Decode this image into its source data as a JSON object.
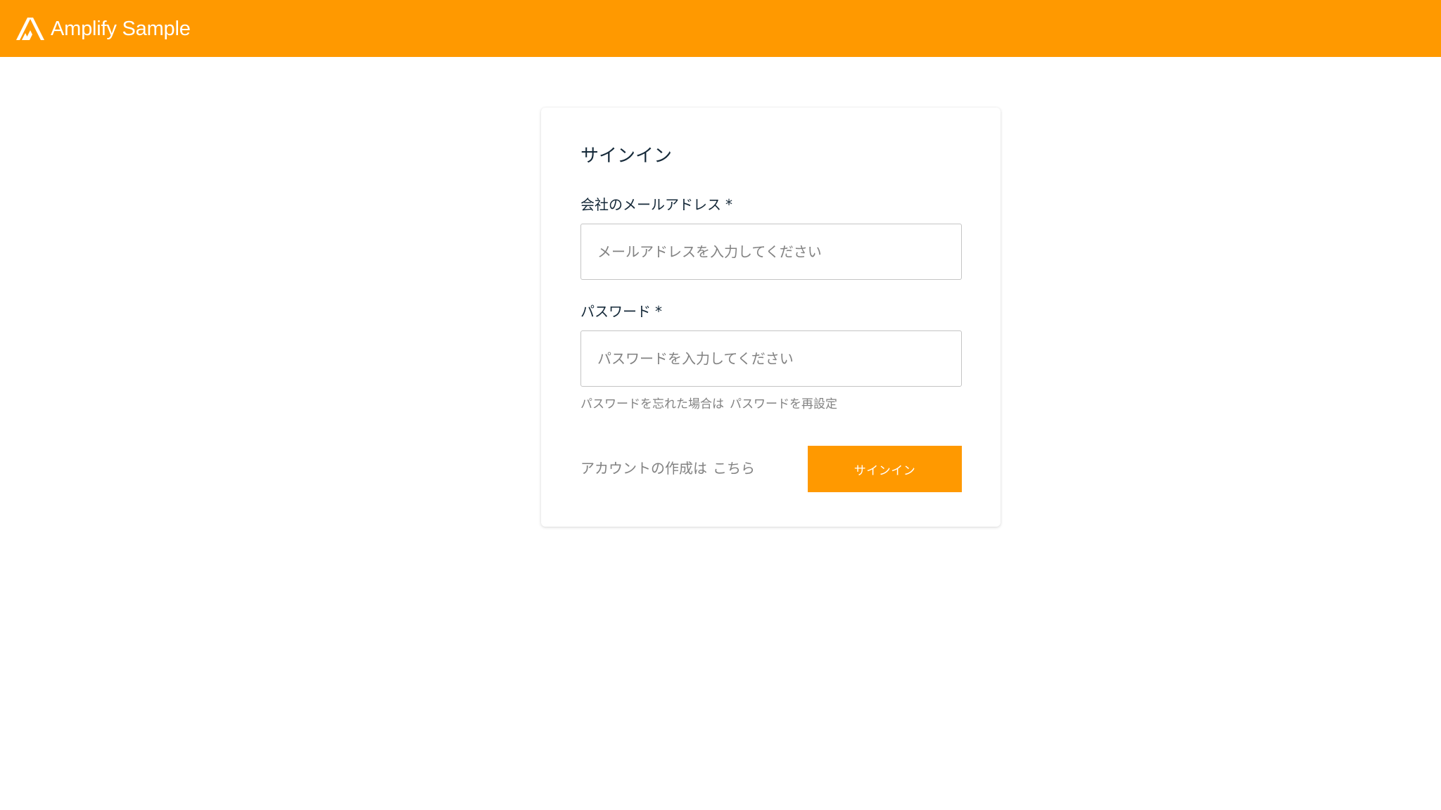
{
  "header": {
    "brand": "Amplify Sample",
    "logo_icon": "amplify-logo-icon",
    "background_color": "#ff9900"
  },
  "signin_card": {
    "title": "サインイン",
    "email": {
      "label": "会社のメールアドレス",
      "required_mark": "*",
      "placeholder": "メールアドレスを入力してください",
      "value": ""
    },
    "password": {
      "label": "パスワード",
      "required_mark": "*",
      "placeholder": "パスワードを入力してください",
      "value": ""
    },
    "forgot": {
      "prefix": "パスワードを忘れた場合は",
      "link_label": "パスワードを再設定"
    },
    "create_account": {
      "prefix": "アカウントの作成は",
      "link_label": "こちら"
    },
    "signin_button_label": "サインイン",
    "accent_color": "#ff9900"
  }
}
